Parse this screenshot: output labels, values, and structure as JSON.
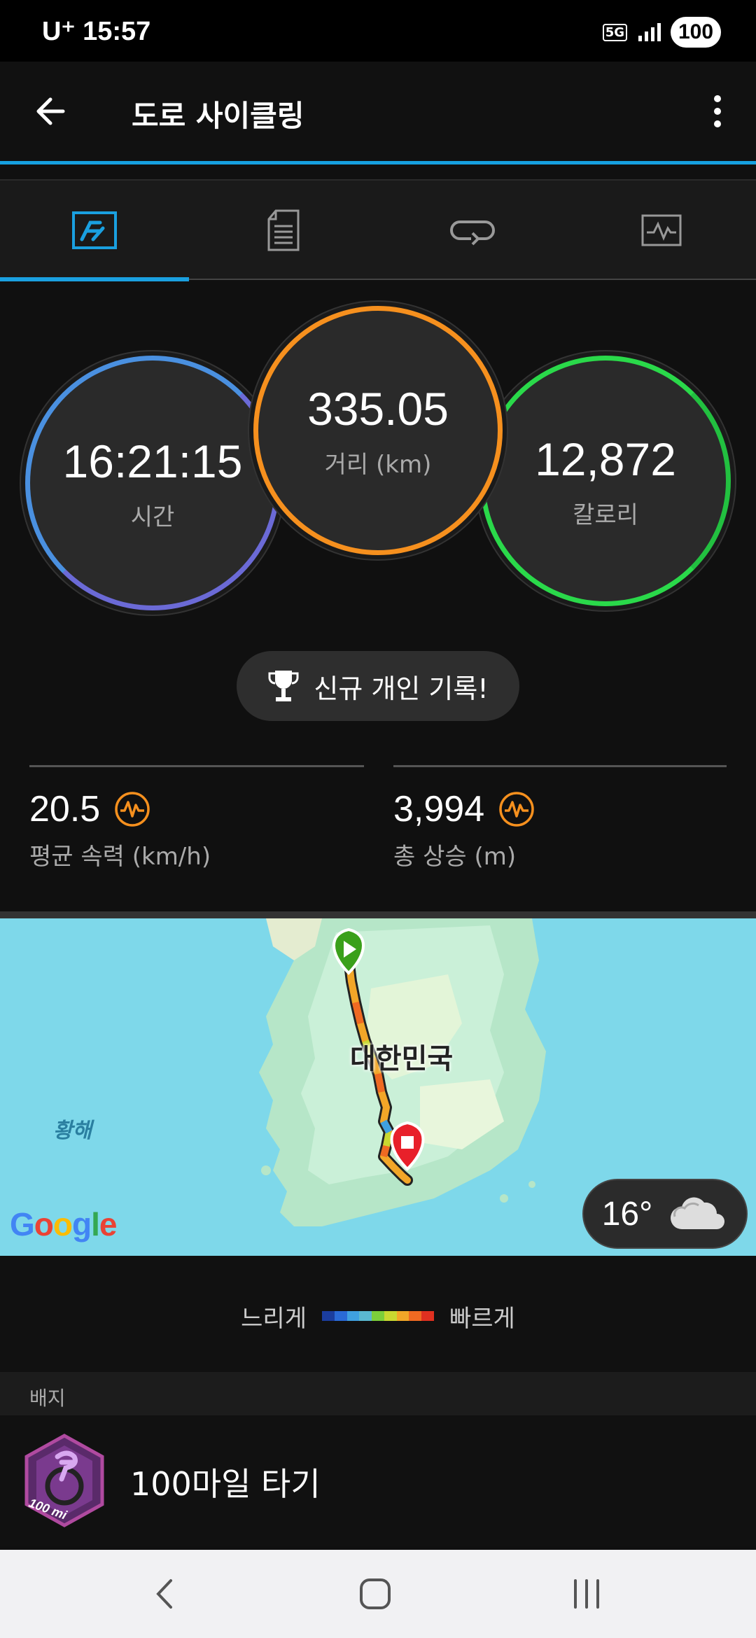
{
  "status_bar": {
    "carrier": "U⁺",
    "time": "15:57",
    "network": "5G",
    "battery": "100"
  },
  "app_bar": {
    "title": "도로 사이클링"
  },
  "tabs": [
    {
      "icon": "summary-icon",
      "active": true
    },
    {
      "icon": "details-list-icon",
      "active": false
    },
    {
      "icon": "laps-icon",
      "active": false
    },
    {
      "icon": "charts-icon",
      "active": false
    }
  ],
  "metrics": {
    "time": {
      "value": "16:21:15",
      "label": "시간"
    },
    "distance": {
      "value": "335.05",
      "label": "거리 (km)"
    },
    "calories": {
      "value": "12,872",
      "label": "칼로리"
    }
  },
  "personal_record": {
    "label": "신규 개인 기록!"
  },
  "stats": {
    "avg_speed": {
      "value": "20.5",
      "label": "평균 속력 (km/h)"
    },
    "total_ascent": {
      "value": "3,994",
      "label": "총 상승 (m)"
    }
  },
  "map": {
    "country_label": "대한민국",
    "sea_label": "황해",
    "provider": "Google",
    "weather_temp": "16°"
  },
  "speed_legend": {
    "slow_label": "느리게",
    "fast_label": "빠르게",
    "colors": [
      "#1b3d9e",
      "#2a6ad6",
      "#3fa0e0",
      "#5ab8d0",
      "#7ccf3a",
      "#c9d830",
      "#f2a628",
      "#ef6a22",
      "#e03020"
    ]
  },
  "badges": {
    "section_title": "배지",
    "items": [
      {
        "title": "100마일 타기",
        "badge_text": "100 mi"
      }
    ]
  },
  "colors": {
    "accent": "#16a0e0",
    "orange": "#f6901e",
    "green": "#2ad94a",
    "purple": "#6b6ad6"
  }
}
